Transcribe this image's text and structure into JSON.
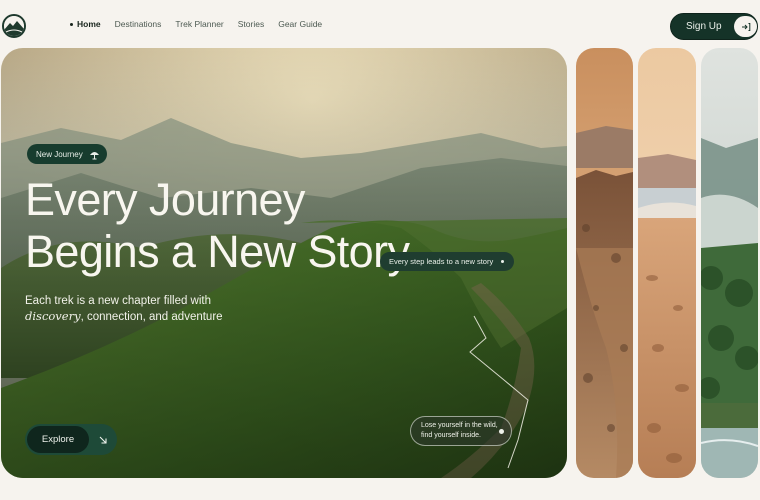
{
  "nav": {
    "items": [
      {
        "label": "Home",
        "active": true
      },
      {
        "label": "Destinations",
        "active": false
      },
      {
        "label": "Trek Planner",
        "active": false
      },
      {
        "label": "Stories",
        "active": false
      },
      {
        "label": "Gear Guide",
        "active": false
      }
    ]
  },
  "header": {
    "signup_label": "Sign Up",
    "signup_icon": "sign-in-arrow-icon"
  },
  "hero": {
    "tag": "New Journey",
    "tag_icon": "hiker-icon",
    "headline_line1": "Every Journey",
    "headline_line2": "Begins a New Story",
    "subtext_line1": "Each trek is a new chapter filled with",
    "subtext_emph": "discovery",
    "subtext_rest": ", connection, and adventure",
    "callout_top": "Every step leads to a new story",
    "callout_bottom_line1": "Lose yourself in the wild,",
    "callout_bottom_line2": "find yourself inside.",
    "explore_label": "Explore",
    "explore_icon": "arrow-down-right-icon"
  },
  "colors": {
    "background": "#f6f3ee",
    "brand_dark": "#153328",
    "accent_green": "#1e4a38"
  },
  "panels": [
    "rocky-ridge-image",
    "beach-sunset-image",
    "misty-forest-river-image"
  ]
}
